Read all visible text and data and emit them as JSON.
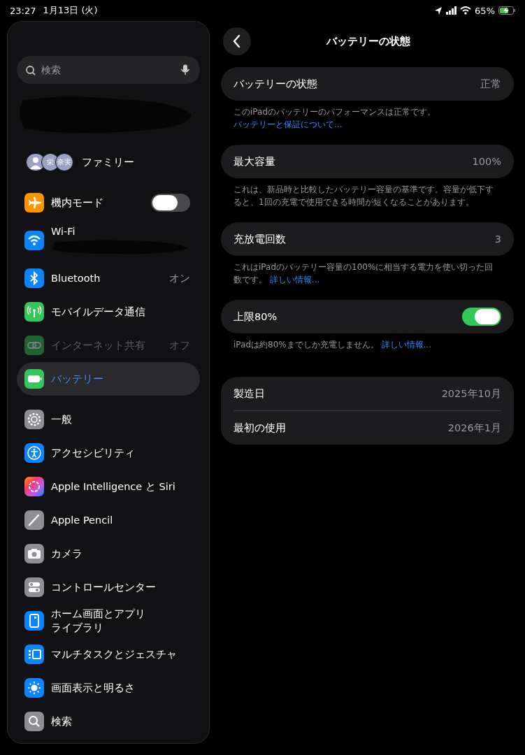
{
  "status_bar": {
    "time": "23:27",
    "date": "1月13日 (火)",
    "battery_percent": "65%"
  },
  "sidebar": {
    "search": {
      "placeholder": "検索"
    },
    "account": {
      "kind": "redacted"
    },
    "family": {
      "label": "ファミリー",
      "avatars": [
        {
          "kind": "silhouette"
        },
        {
          "kind": "initials",
          "text": "栄"
        },
        {
          "kind": "initials",
          "text": "奈実"
        }
      ]
    },
    "groups": [
      [
        {
          "label": "機内モード",
          "kind": "toggle",
          "on": false,
          "selected": false,
          "disabled": false
        },
        {
          "label": "Wi-Fi",
          "kind": "redacted",
          "selected": false,
          "disabled": false
        },
        {
          "label": "Bluetooth",
          "kind": "value",
          "value": "オン",
          "selected": false,
          "disabled": false
        },
        {
          "label": "モバイルデータ通信",
          "kind": "plain",
          "selected": false,
          "disabled": false
        },
        {
          "label": "インターネット共有",
          "kind": "value",
          "value": "オフ",
          "selected": false,
          "disabled": true
        },
        {
          "label": "バッテリー",
          "kind": "plain",
          "selected": true,
          "disabled": false
        }
      ],
      [
        {
          "label": "一般",
          "kind": "plain",
          "selected": false,
          "disabled": false
        },
        {
          "label": "アクセシビリティ",
          "kind": "plain",
          "selected": false,
          "disabled": false
        },
        {
          "label": "Apple Intelligence と Siri",
          "kind": "plain",
          "selected": false,
          "disabled": false
        },
        {
          "label": "Apple Pencil",
          "kind": "plain",
          "selected": false,
          "disabled": false
        },
        {
          "label": "カメラ",
          "kind": "plain",
          "selected": false,
          "disabled": false
        },
        {
          "label": "コントロールセンター",
          "kind": "plain",
          "selected": false,
          "disabled": false
        },
        {
          "label": "ホーム画面とアプリ",
          "label_line_2": "ライブラリ",
          "kind": "plain",
          "selected": false,
          "disabled": false
        },
        {
          "label": "マルチタスクとジェスチャ",
          "kind": "plain",
          "selected": false,
          "disabled": false
        },
        {
          "label": "画面表示と明るさ",
          "kind": "plain",
          "selected": false,
          "disabled": false
        },
        {
          "label": "検索",
          "kind": "plain",
          "selected": false,
          "disabled": false
        }
      ]
    ]
  },
  "detail": {
    "title": "バッテリーの状態",
    "sections": [
      {
        "rows": [
          {
            "kind": "value",
            "label": "バッテリーの状態",
            "value": "正常"
          }
        ],
        "footer": "このiPadのバッテリーのパフォーマンスは正常です。",
        "footer_link": "バッテリーと保証について..."
      },
      {
        "rows": [
          {
            "kind": "value",
            "label": "最大容量",
            "value": "100%"
          }
        ],
        "footer": "これは、新品時と比較したバッテリー容量の基準です。容量が低下すると、1回の充電で使用できる時間が短くなることがあります。"
      },
      {
        "rows": [
          {
            "kind": "value",
            "label": "充放電回数",
            "value": "3"
          }
        ],
        "footer": "これはiPadのバッテリー容量の100%に相当する電力を使い切った回数です。",
        "footer_link": "詳しい情報..."
      },
      {
        "rows": [
          {
            "kind": "toggle",
            "label": "上限80%",
            "on": true
          }
        ],
        "footer": "iPadは約80%までしか充電しません。",
        "footer_link": "詳しい情報..."
      },
      {
        "rows": [
          {
            "kind": "value",
            "label": "製造日",
            "value": "2025年10月"
          },
          {
            "kind": "value",
            "label": "最初の使用",
            "value": "2026年1月"
          }
        ]
      }
    ]
  }
}
